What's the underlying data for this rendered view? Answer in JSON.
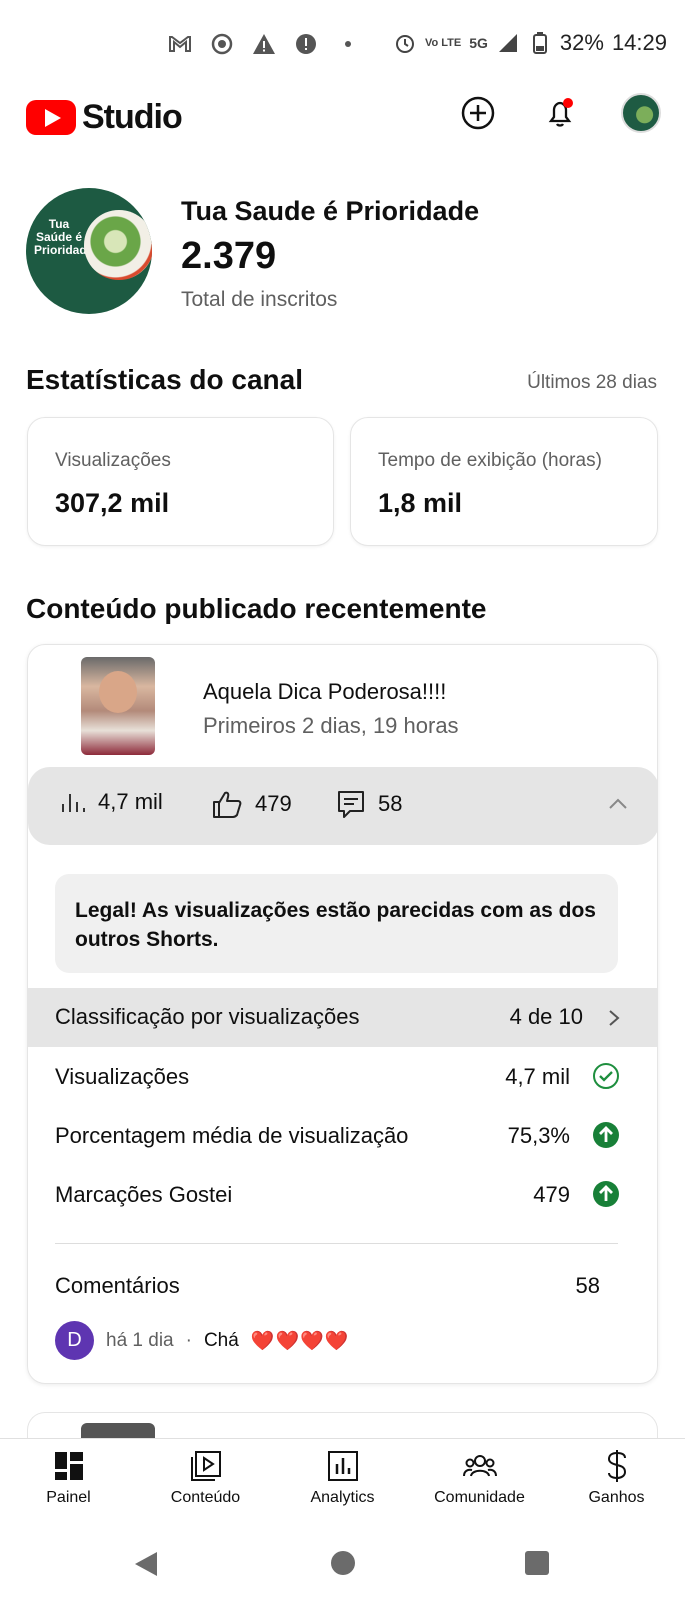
{
  "status_bar": {
    "battery": "32%",
    "time": "14:29",
    "network": "5G",
    "volte": "Vo LTE"
  },
  "app": {
    "logo_text": "Studio",
    "brand_color": "#ff0000"
  },
  "channel": {
    "name": "Tua Saude é Prioridade",
    "subscribers": "2.379",
    "subscribers_label": "Total de inscritos",
    "avatar_text": "Tua Saúde é Prioridade"
  },
  "stats": {
    "title": "Estatísticas do canal",
    "period": "Últimos 28 dias",
    "views_label": "Visualizações",
    "views_value": "307,2 mil",
    "watch_label": "Tempo de exibição (horas)",
    "watch_value": "1,8 mil"
  },
  "recent": {
    "title": "Conteúdo publicado recentemente",
    "video": {
      "title": "Aquela Dica Poderosa!!!!",
      "subtitle": "Primeiros 2 dias, 19 horas",
      "views": "4,7 mil",
      "likes": "479",
      "comments": "58"
    },
    "insight": "Legal! As visualizações estão parecidas com as dos outros Shorts.",
    "ranking": {
      "label": "Classificação por visualizações",
      "value": "4 de 10"
    },
    "rows": [
      {
        "label": "Visualizações",
        "value": "4,7 mil",
        "indicator": "check-circle-icon"
      },
      {
        "label": "Porcentagem média de visualização",
        "value": "75,3%",
        "indicator": "arrow-up-circle-icon"
      },
      {
        "label": "Marcações Gostei",
        "value": "479",
        "indicator": "arrow-up-circle-icon"
      }
    ],
    "comments": {
      "label": "Comentários",
      "count": "58",
      "latest": {
        "avatar_letter": "D",
        "time": "há 1 dia",
        "separator": "·",
        "text": "Chá",
        "emoji": "❤️❤️❤️❤️"
      }
    },
    "indicator_colors": {
      "check": "#1e8e3e",
      "up": "#188038"
    }
  },
  "bottom_nav": [
    {
      "label": "Painel",
      "icon": "dashboard-icon"
    },
    {
      "label": "Conteúdo",
      "icon": "content-icon"
    },
    {
      "label": "Analytics",
      "icon": "analytics-icon"
    },
    {
      "label": "Comunidade",
      "icon": "community-icon"
    },
    {
      "label": "Ganhos",
      "icon": "earnings-icon"
    }
  ]
}
